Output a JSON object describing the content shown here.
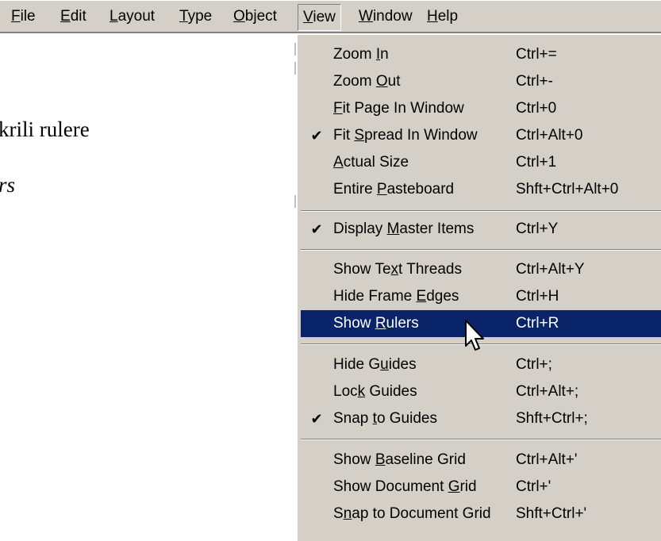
{
  "menubar": {
    "items": [
      {
        "pre": "",
        "u": "F",
        "post": "ile"
      },
      {
        "pre": "",
        "u": "E",
        "post": "dit"
      },
      {
        "pre": "",
        "u": "L",
        "post": "ayout"
      },
      {
        "pre": "",
        "u": "T",
        "post": "ype"
      },
      {
        "pre": "",
        "u": "O",
        "post": "bject"
      },
      {
        "pre": "",
        "u": "V",
        "post": "iew"
      },
      {
        "pre": "",
        "u": "W",
        "post": "indow"
      },
      {
        "pre": "",
        "u": "H",
        "post": "elp"
      }
    ]
  },
  "document": {
    "line1": "krili rulere",
    "line2": "rs"
  },
  "view_menu": {
    "items": [
      {
        "check": "",
        "pre": "Zoom ",
        "u": "I",
        "post": "n",
        "shortcut": "Ctrl+="
      },
      {
        "check": "",
        "pre": "Zoom ",
        "u": "O",
        "post": "ut",
        "shortcut": "Ctrl+-"
      },
      {
        "check": "",
        "pre": "",
        "u": "F",
        "post": "it Page In Window",
        "shortcut": "Ctrl+0"
      },
      {
        "check": "✔",
        "pre": "Fit ",
        "u": "S",
        "post": "pread In Window",
        "shortcut": "Ctrl+Alt+0"
      },
      {
        "check": "",
        "pre": "",
        "u": "A",
        "post": "ctual Size",
        "shortcut": "Ctrl+1"
      },
      {
        "check": "",
        "pre": "Entire ",
        "u": "P",
        "post": "asteboard",
        "shortcut": "Shft+Ctrl+Alt+0"
      },
      {
        "check": "✔",
        "pre": "Display ",
        "u": "M",
        "post": "aster Items",
        "shortcut": "Ctrl+Y"
      },
      {
        "check": "",
        "pre": "Show Te",
        "u": "x",
        "post": "t Threads",
        "shortcut": "Ctrl+Alt+Y"
      },
      {
        "check": "",
        "pre": "Hide Frame ",
        "u": "E",
        "post": "dges",
        "shortcut": "Ctrl+H"
      },
      {
        "check": "",
        "pre": "Show ",
        "u": "R",
        "post": "ulers",
        "shortcut": "Ctrl+R"
      },
      {
        "check": "",
        "pre": "Hide G",
        "u": "u",
        "post": "ides",
        "shortcut": "Ctrl+;"
      },
      {
        "check": "",
        "pre": "Loc",
        "u": "k",
        "post": " Guides",
        "shortcut": "Ctrl+Alt+;"
      },
      {
        "check": "✔",
        "pre": "Snap ",
        "u": "t",
        "post": "o Guides",
        "shortcut": "Shft+Ctrl+;"
      },
      {
        "check": "",
        "pre": "Show ",
        "u": "B",
        "post": "aseline Grid",
        "shortcut": "Ctrl+Alt+'"
      },
      {
        "check": "",
        "pre": "Show Document ",
        "u": "G",
        "post": "rid",
        "shortcut": "Ctrl+'"
      },
      {
        "check": "",
        "pre": "S",
        "u": "n",
        "post": "ap to Document Grid",
        "shortcut": "Shft+Ctrl+'"
      }
    ]
  },
  "colors": {
    "menu_bg": "#d4d0c8",
    "selection_bg": "#0a246a",
    "selection_fg": "#ffffff"
  },
  "icons": {
    "check": "checkmark-icon",
    "cursor": "arrow-cursor-icon"
  }
}
